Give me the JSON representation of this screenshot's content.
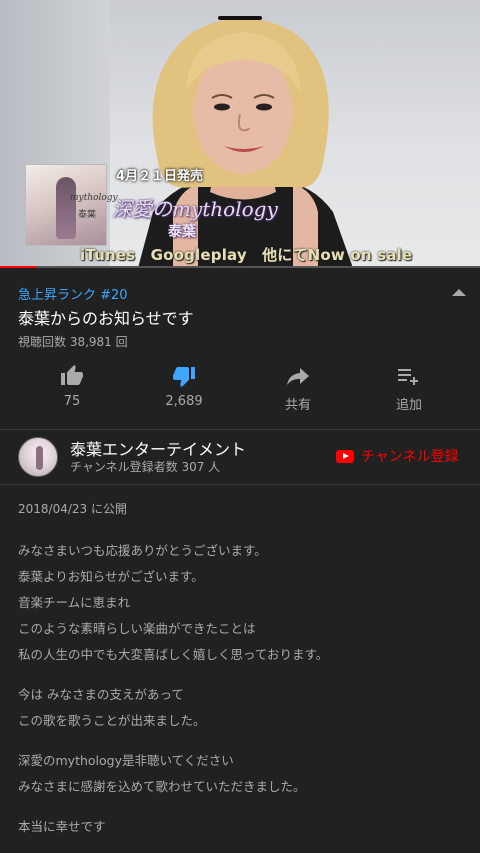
{
  "player": {
    "release_date": "4月２１日発売",
    "album_title": "深愛のmythology",
    "artist": "泰葉",
    "stores": "iTunes　Googleplay　他にてNow on sale",
    "cover_title": "mythology",
    "cover_artist": "泰葉",
    "progress": 0.075,
    "progress_color": "#ff0000"
  },
  "video": {
    "rank": "急上昇ランク #20",
    "title": "泰葉からのお知らせです",
    "views": "視聴回数 38,981 回"
  },
  "actions": [
    {
      "icon": "thumbs-up-icon",
      "label": "75"
    },
    {
      "icon": "thumbs-down-icon",
      "label": "2,689",
      "active_color": "#3ea6ff"
    },
    {
      "icon": "share-icon",
      "label": "共有"
    },
    {
      "icon": "add-to-playlist-icon",
      "label": "追加"
    }
  ],
  "channel": {
    "name": "泰葉エンターテイメント",
    "subscribers": "チャンネル登録者数 307 人",
    "subscribe_label": "チャンネル登録"
  },
  "description": {
    "published": "2018/04/23 に公開",
    "paragraphs": [
      [
        "みなさまいつも応援ありがとうございます。",
        "泰葉よりお知らせがございます。",
        "音楽チームに恵まれ",
        "このような素晴らしい楽曲ができたことは",
        "私の人生の中でも大変喜ばしく嬉しく思っております。"
      ],
      [
        "今は みなさまの支えがあって",
        "この歌を歌うことが出来ました。"
      ],
      [
        "深愛のmythology是非聴いてください",
        "みなさまに感謝を込めて歌わせていただきました。"
      ],
      [
        "本当に幸せです"
      ]
    ]
  },
  "colors": {
    "background": "#212121",
    "accent_blue": "#3ea6ff",
    "subscribe_red": "#ff0000",
    "secondary_text": "#aaaaaa"
  }
}
